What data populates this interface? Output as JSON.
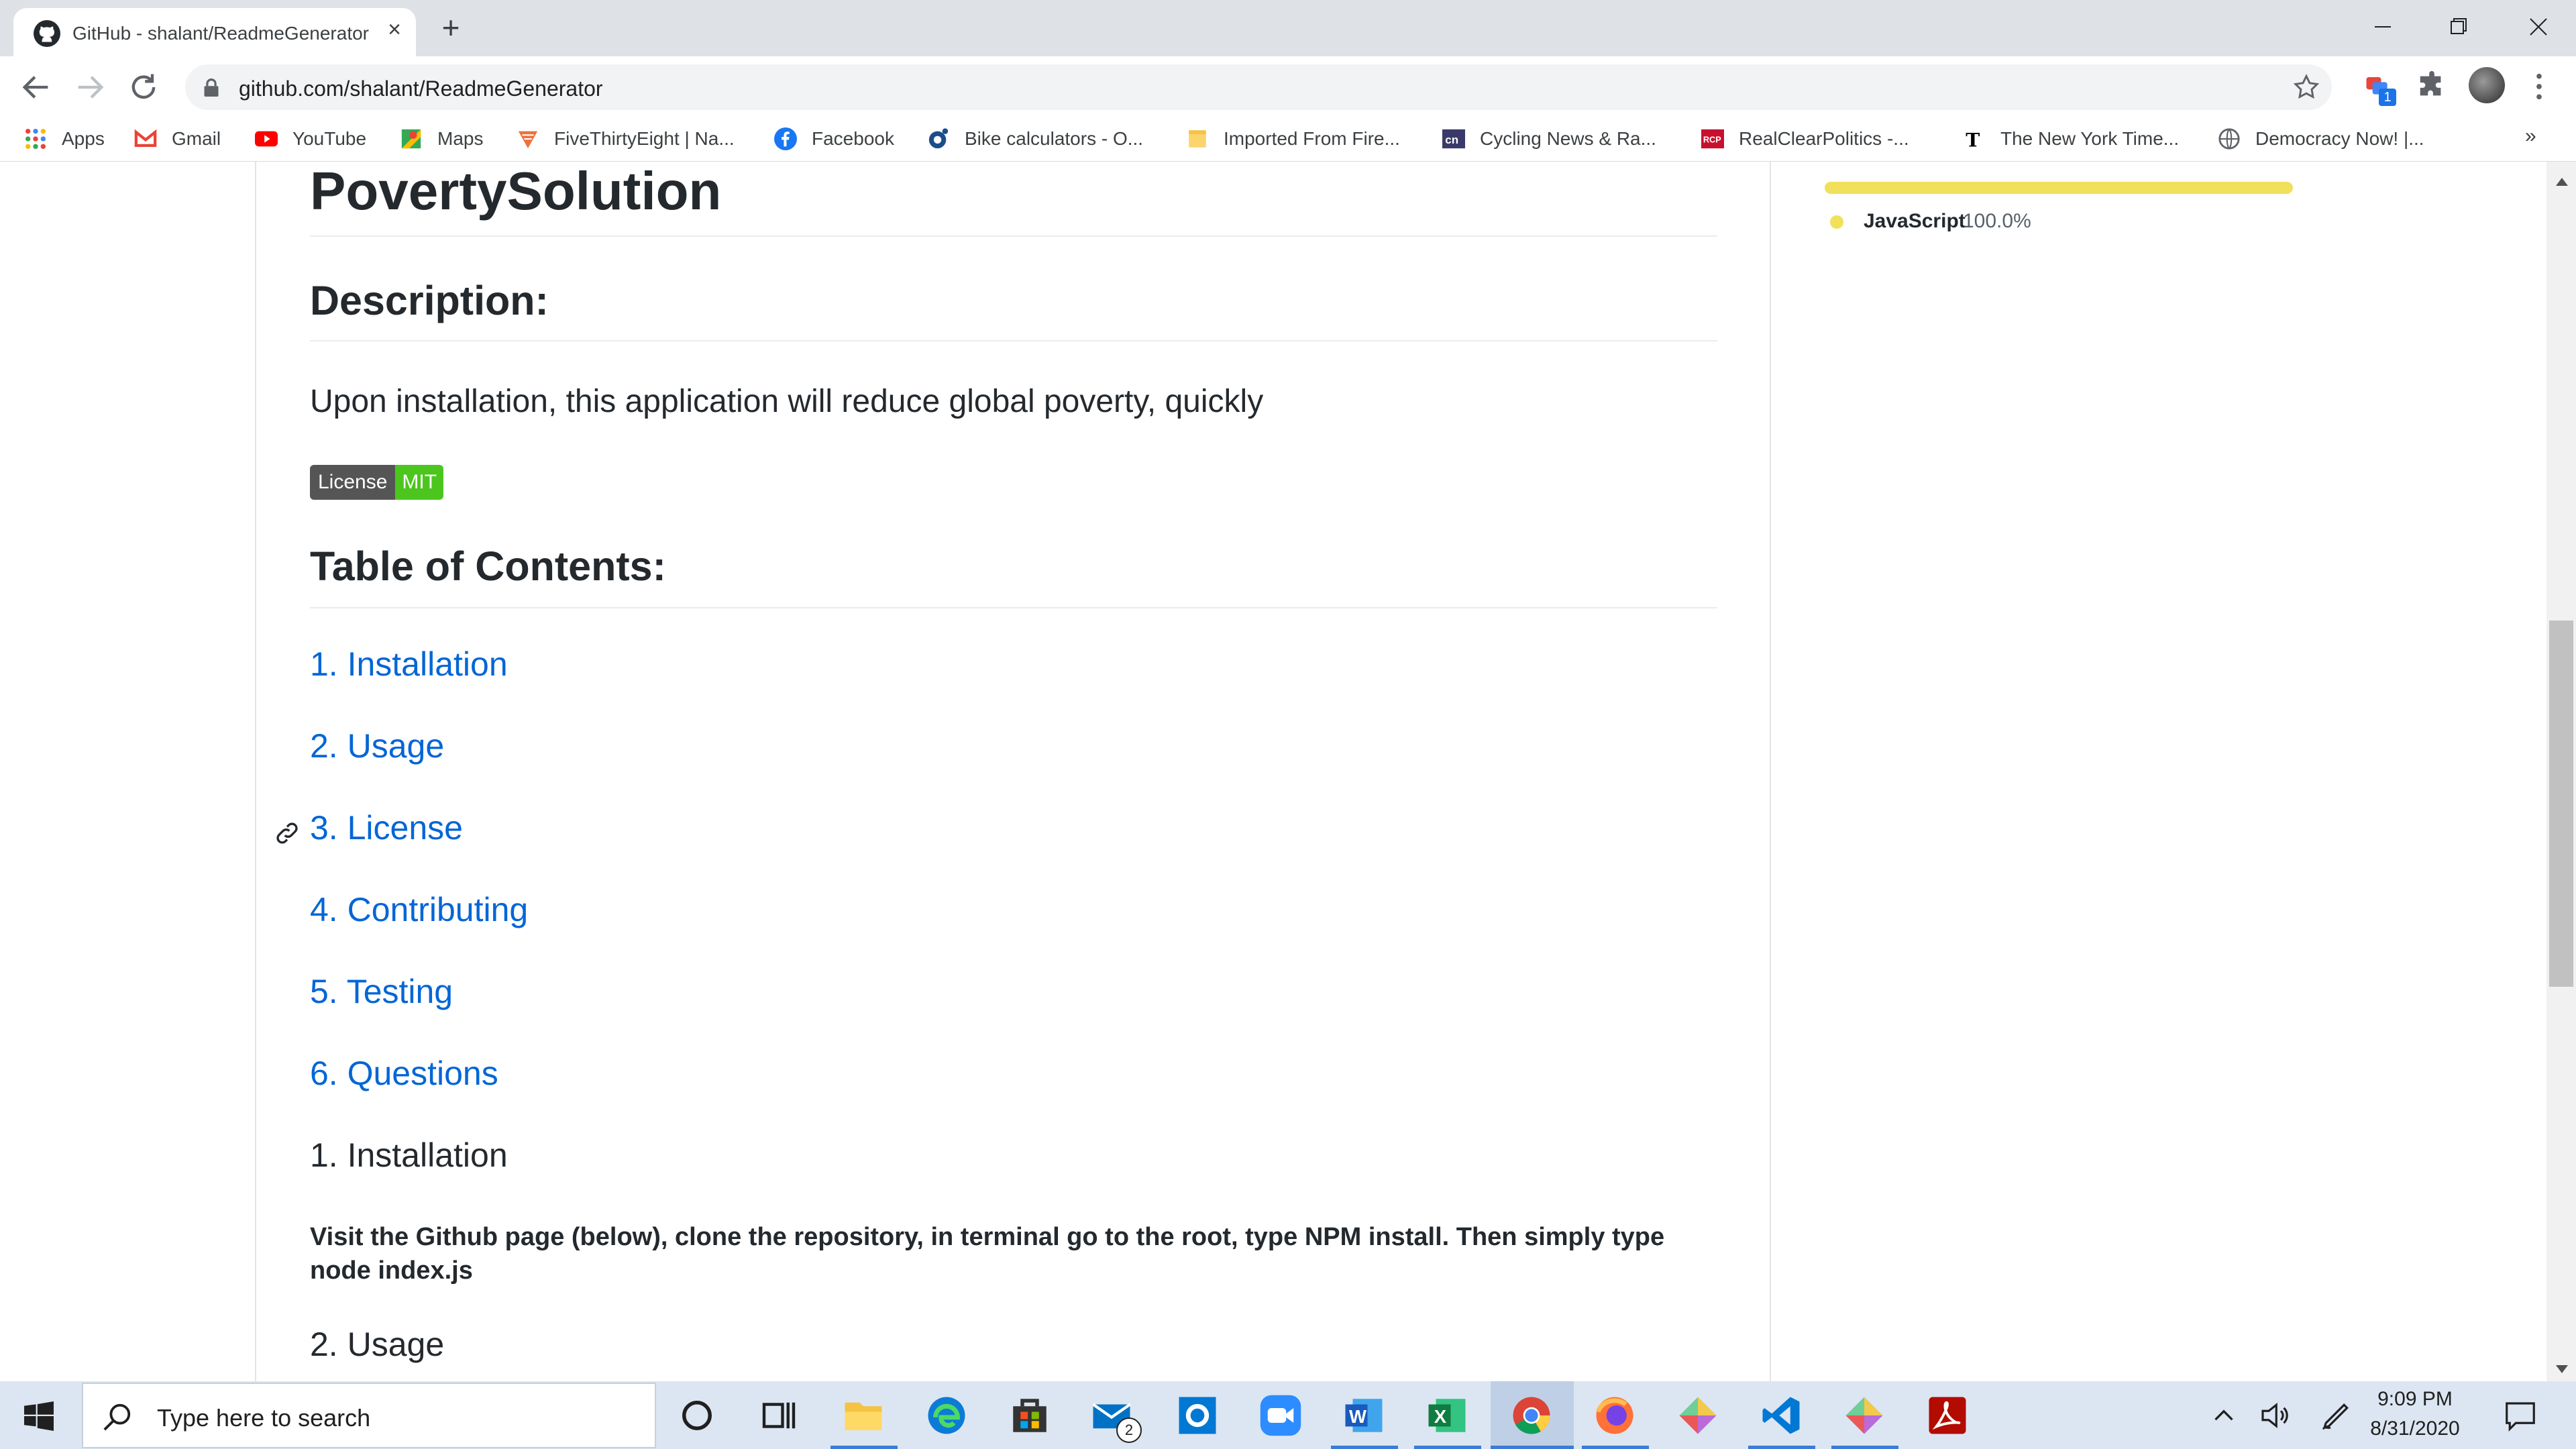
{
  "browser": {
    "tab_title": "GitHub - shalant/ReadmeGenerator",
    "url": "github.com/shalant/ReadmeGenerator",
    "extension_badge": "1"
  },
  "bookmarks": [
    {
      "label": "Apps",
      "icon": "apps-grid-icon"
    },
    {
      "label": "Gmail",
      "icon": "gmail-icon"
    },
    {
      "label": "YouTube",
      "icon": "youtube-icon"
    },
    {
      "label": "Maps",
      "icon": "maps-icon"
    },
    {
      "label": "FiveThirtyEight | Na...",
      "icon": "fivethirtyeight-icon"
    },
    {
      "label": "Facebook",
      "icon": "facebook-icon"
    },
    {
      "label": "Bike calculators - O...",
      "icon": "bike-calculators-icon"
    },
    {
      "label": "Imported From Fire...",
      "icon": "folder-icon"
    },
    {
      "label": "Cycling News & Ra...",
      "icon": "cyclingnews-icon"
    },
    {
      "label": "RealClearPolitics -...",
      "icon": "realclearpolitics-icon"
    },
    {
      "label": "The New York Time...",
      "icon": "nytimes-icon"
    },
    {
      "label": "Democracy Now! |...",
      "icon": "globe-icon"
    }
  ],
  "bookmarks_more": "»",
  "readme": {
    "project_title": "PovertySolution",
    "description_heading": "Description:",
    "description_text": "Upon installation, this application will reduce global poverty, quickly",
    "badge": {
      "left": "License",
      "right": "MIT",
      "right_color": "#4cc61e"
    },
    "toc_heading": "Table of Contents:",
    "toc_items": [
      "1. Installation",
      "2. Usage",
      "3. License",
      "4. Contributing",
      "5. Testing",
      "6. Questions"
    ],
    "installation_heading": "1. Installation",
    "installation_text": "Visit the Github page (below), clone the repository, in terminal go to the root, type NPM install. Then simply type node index.js",
    "usage_heading": "2. Usage"
  },
  "sidebar": {
    "language": "JavaScript",
    "language_percent": "100.0%",
    "language_color": "#f1e05a"
  },
  "taskbar": {
    "search_placeholder": "Type here to search",
    "mail_badge": "2",
    "time": "9:09 PM",
    "date": "8/31/2020"
  }
}
